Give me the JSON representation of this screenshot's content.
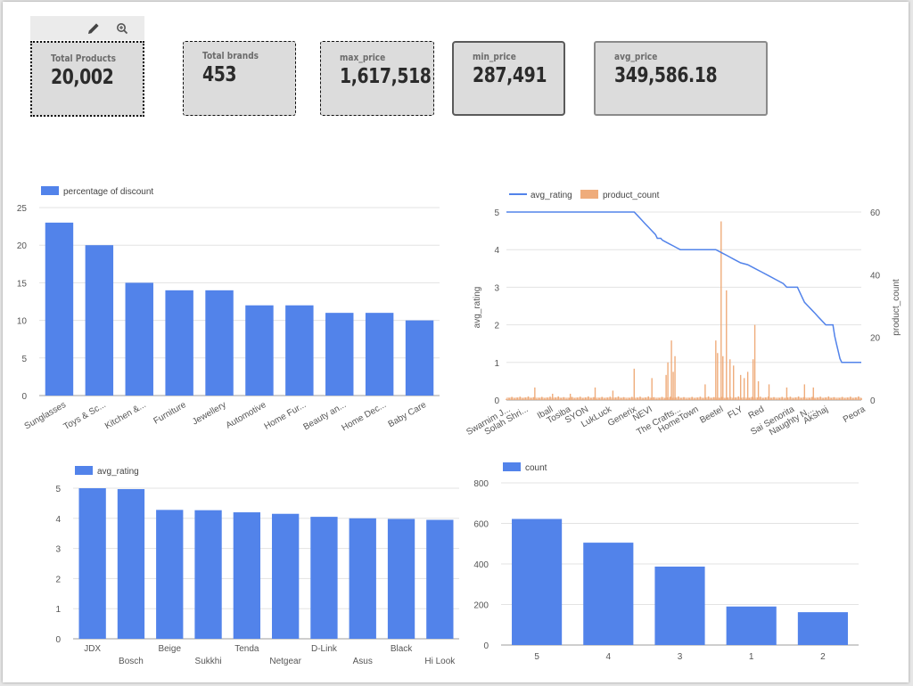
{
  "kpis": [
    {
      "label": "Total Products",
      "value": "20,002"
    },
    {
      "label": "Total brands",
      "value": "453"
    },
    {
      "label": "max_price",
      "value": "1,617,518"
    },
    {
      "label": "min_price",
      "value": "287,491"
    },
    {
      "label": "avg_price",
      "value": "349,586.18"
    }
  ],
  "toolbar": {
    "edit_icon": "pencil-icon",
    "zoom_icon": "zoom-icon"
  },
  "chart_data": [
    {
      "type": "bar",
      "legend": "percentage of discount",
      "legend_position": "top-left",
      "color": "#5283ea",
      "categories": [
        "Sunglasses",
        "Toys & Sc...",
        "Kitchen &...",
        "Furniture",
        "Jewellery",
        "Automotive",
        "Home Fur...",
        "Beauty an...",
        "Home Dec...",
        "Baby Care"
      ],
      "values": [
        23,
        20,
        15,
        14,
        14,
        12,
        12,
        11,
        11,
        10
      ],
      "ylim": [
        0,
        25
      ],
      "yticks": [
        "0",
        "5",
        "10",
        "15",
        "20",
        "25"
      ],
      "grid": true
    },
    {
      "type": "line",
      "legend_position": "top-left",
      "series": [
        {
          "name": "avg_rating",
          "kind": "line",
          "color": "#5283ea",
          "axis": "left"
        },
        {
          "name": "product_count",
          "kind": "bar",
          "color": "#efac7b",
          "axis": "right"
        }
      ],
      "ylabel": "avg_rating",
      "y2label": "product_count",
      "ylim": [
        0,
        5
      ],
      "y2lim": [
        0,
        60
      ],
      "yticks": [
        "0",
        "1",
        "2",
        "3",
        "4",
        "5"
      ],
      "y2ticks": [
        "0",
        "20",
        "40",
        "60"
      ],
      "x_tick_labels": [
        "Swarnim J...",
        "Solah Shri...",
        "Iball",
        "Tosiba",
        "SYON",
        "LukLuck",
        "Generix",
        "NEVI",
        "The Crafts...",
        "HomeTown",
        "Beetel",
        "FLY",
        "Red",
        "Sai Senorita",
        "Naughty N...",
        "Akshaj",
        "Peora"
      ],
      "x_positions": [
        0,
        0.05,
        0.12,
        0.17,
        0.22,
        0.285,
        0.355,
        0.4,
        0.48,
        0.53,
        0.6,
        0.655,
        0.715,
        0.8,
        0.855,
        0.895,
        1.0
      ],
      "avg_rating_points": [
        [
          0,
          5
        ],
        [
          0.36,
          5
        ],
        [
          0.37,
          4.9
        ],
        [
          0.38,
          4.8
        ],
        [
          0.39,
          4.7
        ],
        [
          0.4,
          4.6
        ],
        [
          0.41,
          4.5
        ],
        [
          0.42,
          4.4
        ],
        [
          0.425,
          4.3
        ],
        [
          0.435,
          4.3
        ],
        [
          0.44,
          4.25
        ],
        [
          0.45,
          4.2
        ],
        [
          0.46,
          4.15
        ],
        [
          0.47,
          4.1
        ],
        [
          0.48,
          4.05
        ],
        [
          0.49,
          4.0
        ],
        [
          0.5,
          4.0
        ],
        [
          0.59,
          4.0
        ],
        [
          0.6,
          3.95
        ],
        [
          0.61,
          3.9
        ],
        [
          0.62,
          3.85
        ],
        [
          0.63,
          3.8
        ],
        [
          0.64,
          3.75
        ],
        [
          0.65,
          3.7
        ],
        [
          0.66,
          3.65
        ],
        [
          0.68,
          3.6
        ],
        [
          0.7,
          3.5
        ],
        [
          0.72,
          3.4
        ],
        [
          0.74,
          3.3
        ],
        [
          0.76,
          3.2
        ],
        [
          0.78,
          3.1
        ],
        [
          0.79,
          3.0
        ],
        [
          0.82,
          3.0
        ],
        [
          0.83,
          2.8
        ],
        [
          0.84,
          2.6
        ],
        [
          0.85,
          2.5
        ],
        [
          0.86,
          2.4
        ],
        [
          0.87,
          2.3
        ],
        [
          0.88,
          2.2
        ],
        [
          0.9,
          2.0
        ],
        [
          0.92,
          2.0
        ],
        [
          0.925,
          1.7
        ],
        [
          0.93,
          1.5
        ],
        [
          0.935,
          1.3
        ],
        [
          0.94,
          1.1
        ],
        [
          0.945,
          1.0
        ],
        [
          1.0,
          1.0
        ]
      ],
      "product_count_spikes": [
        [
          0.36,
          10
        ],
        [
          0.41,
          7
        ],
        [
          0.45,
          8
        ],
        [
          0.455,
          12
        ],
        [
          0.465,
          19
        ],
        [
          0.475,
          14
        ],
        [
          0.47,
          9
        ],
        [
          0.56,
          5
        ],
        [
          0.59,
          19
        ],
        [
          0.595,
          15
        ],
        [
          0.605,
          57
        ],
        [
          0.61,
          14
        ],
        [
          0.62,
          35
        ],
        [
          0.63,
          13
        ],
        [
          0.64,
          11
        ],
        [
          0.66,
          8
        ],
        [
          0.67,
          7
        ],
        [
          0.68,
          9
        ],
        [
          0.695,
          13
        ],
        [
          0.7,
          24
        ],
        [
          0.71,
          6
        ],
        [
          0.74,
          5
        ],
        [
          0.79,
          4
        ],
        [
          0.84,
          5
        ],
        [
          0.865,
          4
        ],
        [
          0.08,
          4
        ],
        [
          0.25,
          4
        ],
        [
          0.3,
          3
        ],
        [
          0.18,
          2
        ],
        [
          0.13,
          2
        ]
      ]
    },
    {
      "type": "bar",
      "legend": "avg_rating",
      "legend_position": "top-left",
      "color": "#5283ea",
      "categories": [
        "JDX",
        "Bosch",
        "Beige",
        "Sukkhi",
        "Tenda",
        "Netgear",
        "D-Link",
        "Asus",
        "Black",
        "Hi Look"
      ],
      "values": [
        5.0,
        4.97,
        4.28,
        4.27,
        4.2,
        4.15,
        4.05,
        4.0,
        3.98,
        3.95
      ],
      "ylim": [
        0,
        5
      ],
      "yticks": [
        "0",
        "1",
        "2",
        "3",
        "4",
        "5"
      ],
      "grid": true
    },
    {
      "type": "bar",
      "legend": "count",
      "legend_position": "top-left",
      "color": "#5283ea",
      "categories": [
        "5",
        "4",
        "3",
        "1",
        "2"
      ],
      "values": [
        622,
        505,
        387,
        190,
        162
      ],
      "ylim": [
        0,
        800
      ],
      "yticks": [
        "0",
        "200",
        "400",
        "600",
        "800"
      ],
      "grid": true
    }
  ]
}
